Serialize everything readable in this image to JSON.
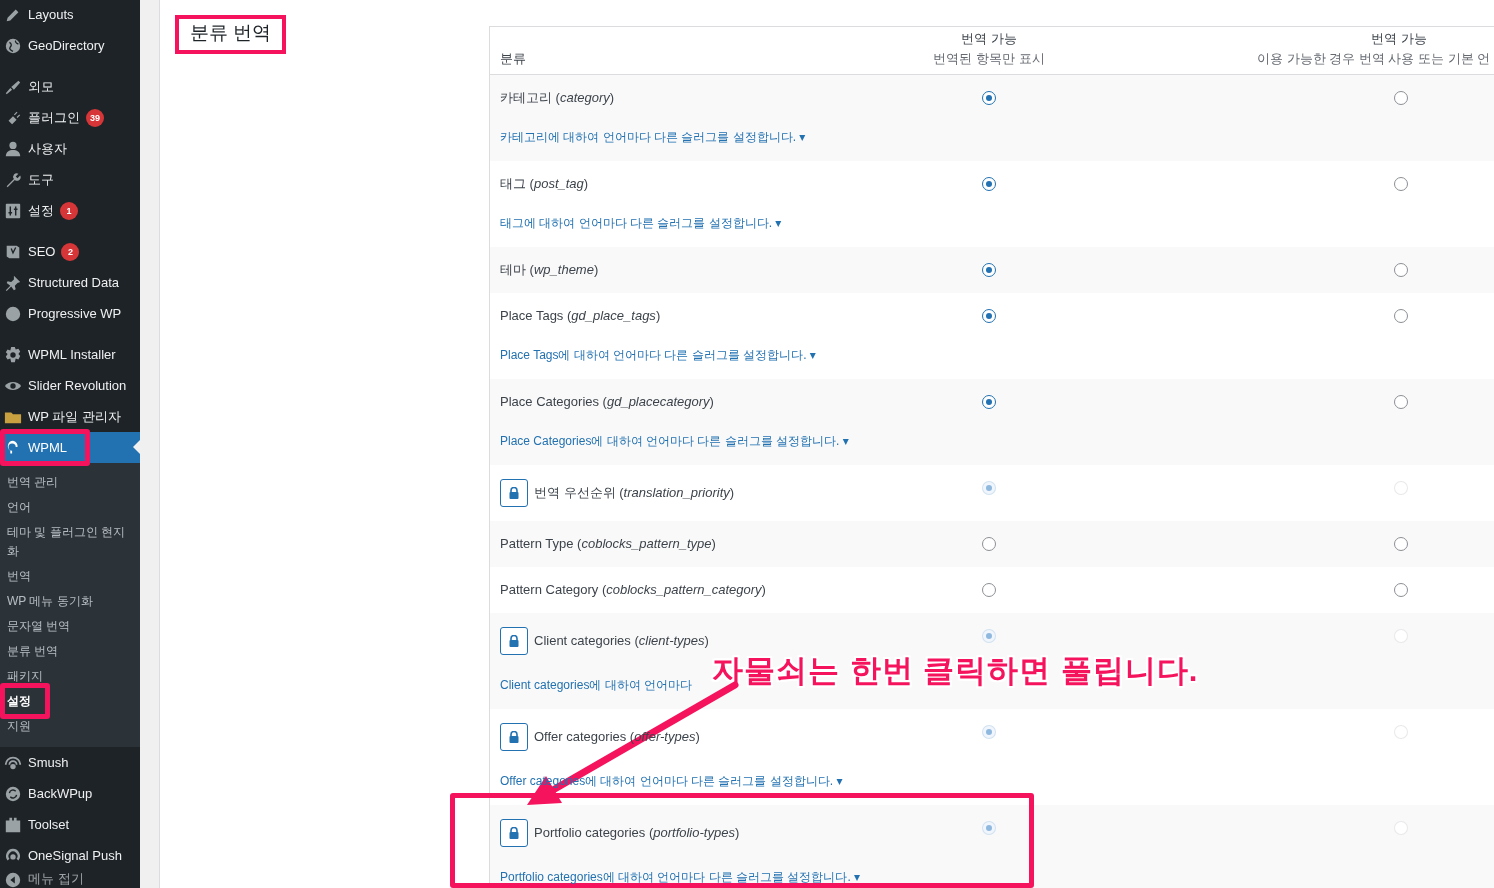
{
  "sidebar": {
    "groups": [
      [
        {
          "label": "Layouts",
          "selected": false
        },
        {
          "label": "GeoDirectory",
          "selected": false
        }
      ],
      [
        {
          "label": "외모",
          "selected": false
        },
        {
          "label": "플러그인",
          "badge": "39",
          "selected": false
        },
        {
          "label": "사용자",
          "selected": false
        },
        {
          "label": "도구",
          "selected": false
        },
        {
          "label": "설정",
          "badge": "1",
          "selected": false
        }
      ],
      [
        {
          "label": "SEO",
          "badge": "2",
          "selected": false
        },
        {
          "label": "Structured Data",
          "selected": false
        },
        {
          "label": "Progressive WP",
          "selected": false
        }
      ],
      [
        {
          "label": "WPML Installer",
          "selected": false
        },
        {
          "label": "Slider Revolution",
          "selected": false
        },
        {
          "label": "WP 파일 관리자",
          "selected": false
        },
        {
          "label": "WPML",
          "selected": true,
          "highlighted": true,
          "submenu": [
            {
              "label": "번역 관리",
              "selected": false,
              "highlighted": false
            },
            {
              "label": "언어",
              "selected": false,
              "highlighted": false
            },
            {
              "label": "테마 및 플러그인 현지화",
              "selected": false,
              "highlighted": false
            },
            {
              "label": "번역",
              "selected": false,
              "highlighted": false
            },
            {
              "label": "WP 메뉴 동기화",
              "selected": false,
              "highlighted": false
            },
            {
              "label": "문자열 번역",
              "selected": false,
              "highlighted": false
            },
            {
              "label": "분류 번역",
              "selected": false,
              "highlighted": false
            },
            {
              "label": "패키지",
              "selected": false,
              "highlighted": false
            },
            {
              "label": "설정",
              "selected": true,
              "highlighted": true
            },
            {
              "label": "지원",
              "selected": false,
              "highlighted": false
            }
          ]
        },
        {
          "label": "Smush",
          "selected": false
        },
        {
          "label": "BackWPup",
          "selected": false
        },
        {
          "label": "Toolset",
          "selected": false
        },
        {
          "label": "OneSignal Push",
          "selected": false
        }
      ]
    ],
    "collapse": "메뉴 접기"
  },
  "page": {
    "title": "분류 번역",
    "title_highlighted": true
  },
  "table": {
    "columns": [
      {
        "title": "분류"
      },
      {
        "title": "번역 가능",
        "subtitle": "번역된 항목만 표시"
      },
      {
        "title": "번역 가능",
        "subtitle": "이용 가능한 경우 번역 사용 또는 기본 언"
      }
    ],
    "rows": [
      {
        "name": "카테고리 (*category*)",
        "locked": false,
        "highlighted": false,
        "options": [
          {
            "selected": true
          },
          {
            "selected": false
          }
        ],
        "slug_link": "카테고리에 대하여 언어마다 다른 슬러그를 설정합니다. ▾"
      },
      {
        "name": "태그 (*post_tag*)",
        "locked": false,
        "highlighted": false,
        "options": [
          {
            "selected": true
          },
          {
            "selected": false
          }
        ],
        "slug_link": "태그에 대하여 언어마다 다른 슬러그를 설정합니다. ▾"
      },
      {
        "name": "테마 (*wp_theme*)",
        "locked": false,
        "highlighted": false,
        "options": [
          {
            "selected": true
          },
          {
            "selected": false
          }
        ]
      },
      {
        "name": "Place Tags (*gd_place_tags*)",
        "locked": false,
        "highlighted": false,
        "options": [
          {
            "selected": true
          },
          {
            "selected": false
          }
        ],
        "slug_link": "Place Tags에 대하여 언어마다 다른 슬러그를 설정합니다. ▾"
      },
      {
        "name": "Place Categories (*gd_placecategory*)",
        "locked": false,
        "highlighted": false,
        "options": [
          {
            "selected": true
          },
          {
            "selected": false
          }
        ],
        "slug_link": "Place Categories에 대하여 언어마다 다른 슬러그를 설정합니다. ▾"
      },
      {
        "name": "번역 우선순위 (*translation_priority*)",
        "locked": true,
        "highlighted": false,
        "options": [
          {
            "selected": true
          },
          {
            "selected": false
          }
        ]
      },
      {
        "name": "Pattern Type (*coblocks_pattern_type*)",
        "locked": false,
        "highlighted": false,
        "options": [
          {
            "selected": false
          },
          {
            "selected": false
          }
        ]
      },
      {
        "name": "Pattern Category (*coblocks_pattern_category*)",
        "locked": false,
        "highlighted": false,
        "options": [
          {
            "selected": false
          },
          {
            "selected": false
          }
        ]
      },
      {
        "name": "Client categories (*client-types*)",
        "locked": true,
        "highlighted": false,
        "options": [
          {
            "selected": true
          },
          {
            "selected": false
          }
        ],
        "slug_link": "Client categories에 대하여 언어마다"
      },
      {
        "name": "Offer categories (*offer-types*)",
        "locked": true,
        "highlighted": false,
        "options": [
          {
            "selected": true
          },
          {
            "selected": false
          }
        ],
        "slug_link": "Offer categories에 대하여 언어마다 다른 슬러그를 설정합니다. ▾"
      },
      {
        "name": "Portfolio categories (*portfolio-types*)",
        "locked": true,
        "highlighted": true,
        "options": [
          {
            "selected": true
          },
          {
            "selected": false
          }
        ],
        "slug_link": "Portfolio categories에 대하여 언어마다 다른 슬러그를 설정합니다. ▾"
      }
    ]
  },
  "annotation": {
    "text": "자물쇠는 한번 클릭하면 풀립니다."
  }
}
